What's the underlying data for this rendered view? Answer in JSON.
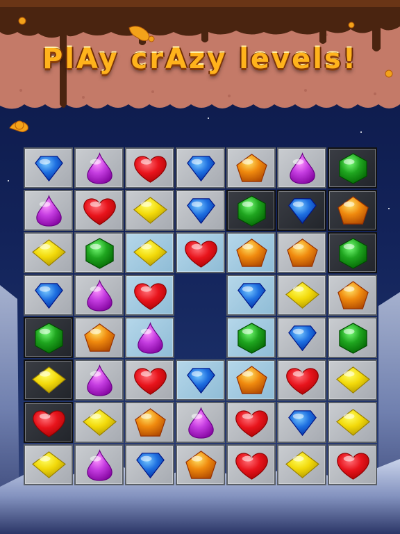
{
  "banner": {
    "title": "PlAy crAzy levels!"
  },
  "colors": {
    "red": "#e8141c",
    "blue": "#1e6fe0",
    "purple": "#c43ce0",
    "yellow": "#f2d90a",
    "green": "#1fa51f",
    "orange": "#f08a0e"
  },
  "gem_icons": {
    "red": "red-heart-gem-icon",
    "blue": "blue-diamond-gem-icon",
    "purple": "purple-drop-gem-icon",
    "yellow": "yellow-rhombus-gem-icon",
    "green": "green-hexagon-gem-icon",
    "orange": "orange-pentagon-gem-icon"
  },
  "board": {
    "rows": 8,
    "cols": 7,
    "gems": [
      [
        "blue",
        "purple",
        "red",
        "blue",
        "orange",
        "purple",
        "green"
      ],
      [
        "purple",
        "red",
        "yellow",
        "blue",
        "green",
        "blue",
        "orange"
      ],
      [
        "yellow",
        "green",
        "yellow",
        "red",
        "orange",
        "orange",
        "green"
      ],
      [
        "blue",
        "purple",
        "red",
        "",
        "blue",
        "yellow",
        "orange"
      ],
      [
        "green",
        "orange",
        "purple",
        "",
        "green",
        "blue",
        "green"
      ],
      [
        "yellow",
        "purple",
        "red",
        "blue",
        "orange",
        "red",
        "yellow"
      ],
      [
        "red",
        "yellow",
        "orange",
        "purple",
        "red",
        "blue",
        "yellow"
      ],
      [
        "yellow",
        "purple",
        "blue",
        "orange",
        "red",
        "yellow",
        "red"
      ]
    ],
    "tiles": [
      [
        "gray",
        "gray",
        "gray",
        "gray",
        "gray",
        "gray",
        "dark"
      ],
      [
        "gray",
        "gray",
        "gray",
        "gray",
        "dark",
        "dark",
        "dark"
      ],
      [
        "gray",
        "gray",
        "blue",
        "blue",
        "blue",
        "gray",
        "dark"
      ],
      [
        "gray",
        "gray",
        "blue",
        "empty",
        "blue",
        "gray",
        "gray"
      ],
      [
        "dark",
        "gray",
        "blue",
        "empty",
        "blue",
        "gray",
        "gray"
      ],
      [
        "dark",
        "gray",
        "gray",
        "blue",
        "blue",
        "gray",
        "gray"
      ],
      [
        "dark",
        "gray",
        "gray",
        "gray",
        "gray",
        "gray",
        "gray"
      ],
      [
        "gray",
        "gray",
        "gray",
        "gray",
        "gray",
        "gray",
        "gray"
      ]
    ]
  }
}
